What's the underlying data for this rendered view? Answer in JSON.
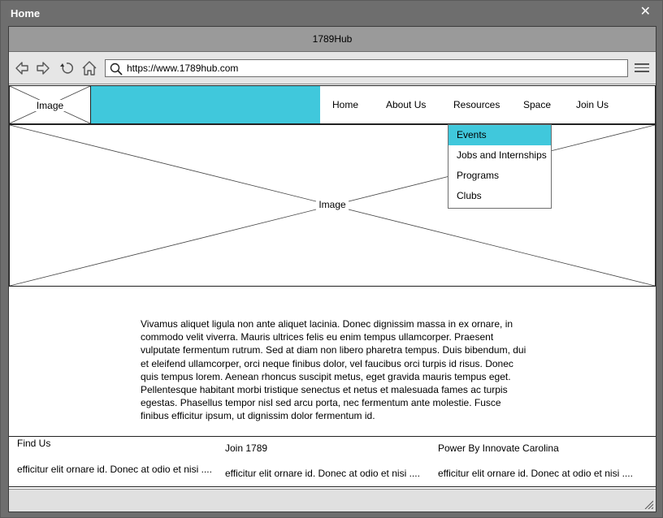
{
  "window": {
    "title": "Home"
  },
  "browser": {
    "tab_title": "1789Hub",
    "url": "https://www.1789hub.com"
  },
  "site": {
    "logo_label": "Image",
    "nav": [
      "Home",
      "About Us",
      "Resources",
      "Space",
      "Join Us"
    ],
    "dropdown": {
      "items": [
        "Events",
        "Jobs and Internships",
        "Programs",
        "Clubs"
      ],
      "active_index": 0
    },
    "hero_label": "Image",
    "body_text": "Vivamus aliquet ligula non ante aliquet lacinia. Donec dignissim massa in ex ornare, in commodo velit viverra. Mauris ultrices felis eu enim tempus ullamcorper. Praesent vulputate fermentum rutrum. Sed at diam non libero pharetra tempus. Duis bibendum, dui et eleifend ullamcorper, orci neque finibus dolor, vel faucibus orci turpis id risus. Donec quis tempus lorem. Aenean rhoncus suscipit metus, eget gravida mauris tempus eget. Pellentesque habitant morbi tristique senectus et netus et malesuada fames ac turpis egestas. Phasellus tempor nisl sed arcu porta, nec fermentum ante molestie. Fusce finibus efficitur ipsum, ut dignissim dolor fermentum id.",
    "footer": [
      {
        "title": "Find Us",
        "text": "efficitur elit ornare id. Donec at odio et nisi ...."
      },
      {
        "title": "Join 1789",
        "text": "efficitur elit ornare id. Donec at odio et nisi ...."
      },
      {
        "title": "Power By Innovate Carolina",
        "text": "efficitur elit ornare id. Donec at odio et nisi ...."
      }
    ]
  },
  "colors": {
    "accent": "#40c8dc",
    "chrome": "#6e6e6e",
    "tabbar": "#9a9a9a"
  },
  "icons": [
    "close-icon",
    "back-icon",
    "forward-icon",
    "reload-icon",
    "home-icon",
    "search-icon",
    "hamburger-menu-icon",
    "resize-grip-icon"
  ]
}
